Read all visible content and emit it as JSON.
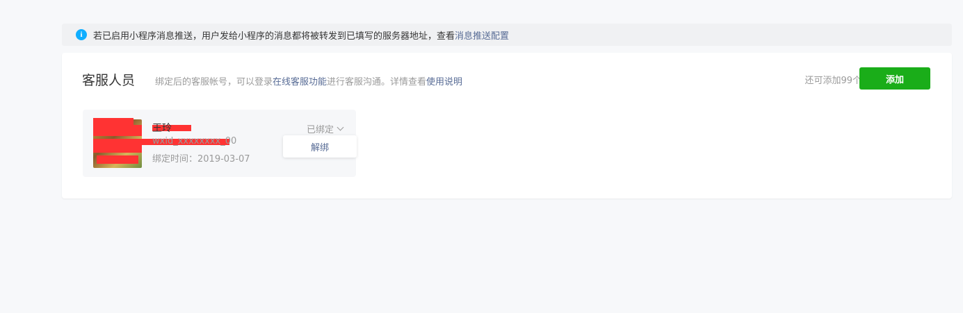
{
  "notice": {
    "icon": "info-icon",
    "icon_glyph": "i",
    "text": "若已启用小程序消息推送，用户发给小程序的消息都将被转发到已填写的服务器地址，查看",
    "link": "消息推送配置"
  },
  "section": {
    "title": "客服人员",
    "desc_prefix": "绑定后的客服帐号，可以登录",
    "desc_link1": "在线客服功能",
    "desc_middle": "进行客服沟通。详情查看",
    "desc_link2": "使用说明",
    "remaining": "还可添加99个",
    "add_label": "添加"
  },
  "staff": [
    {
      "name": "王玲",
      "account": "wxid_xxxxxxxx_00",
      "bind_time": "绑定时间：2019-03-07",
      "status": "已绑定",
      "menu_item": "解绑"
    }
  ],
  "colors": {
    "accent_green": "#1aad19",
    "link_blue": "#576b95",
    "info_blue": "#10aeff",
    "redaction": "#ff3333"
  }
}
